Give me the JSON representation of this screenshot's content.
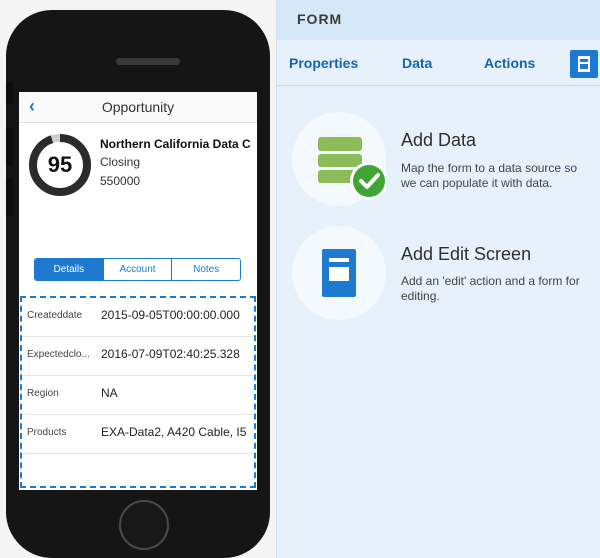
{
  "phone_screen": {
    "nav": {
      "back_icon": "chevron-left-icon",
      "title": "Opportunity"
    },
    "score": {
      "value": "95",
      "progress": 0.95
    },
    "opportunity": {
      "name": "Northern California Data C",
      "stage": "Closing",
      "amount": "550000"
    },
    "tabs": [
      {
        "label": "Details",
        "active": true
      },
      {
        "label": "Account",
        "active": false
      },
      {
        "label": "Notes",
        "active": false
      }
    ],
    "fields": [
      {
        "label": "Createddate",
        "value": "2015-09-05T00:00:00.000"
      },
      {
        "label": "Expectedclo...",
        "value": "2016-07-09T02:40:25.328"
      },
      {
        "label": "Region",
        "value": "NA"
      },
      {
        "label": "Products",
        "value": "EXA-Data2, A420 Cable, I5"
      }
    ]
  },
  "panel": {
    "title": "FORM",
    "tabs": [
      "Properties",
      "Data",
      "Actions"
    ],
    "action_button_icon": "form-layout-icon",
    "actions": [
      {
        "title": "Add Data",
        "description": "Map the form to a data source so we can populate it with data.",
        "icon": "database-check-icon"
      },
      {
        "title": "Add Edit Screen",
        "description": "Add an 'edit' action and a form for editing.",
        "icon": "edit-screen-icon"
      }
    ]
  },
  "colors": {
    "accent": "#1d7ad0",
    "panel_bg": "#e6f1fb",
    "database_green": "#8cbc5a",
    "check_green": "#3fa535"
  }
}
